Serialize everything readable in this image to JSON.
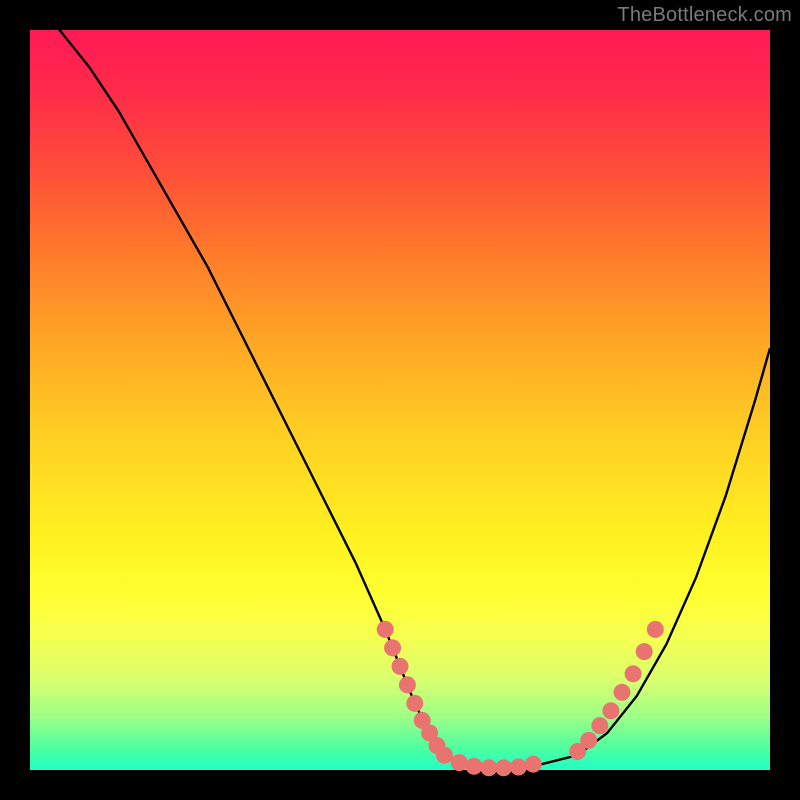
{
  "watermark": "TheBottleneck.com",
  "colors": {
    "background": "#000000",
    "curve": "#000000",
    "dot": "#e9736f"
  },
  "chart_data": {
    "type": "line",
    "title": "",
    "xlabel": "",
    "ylabel": "",
    "xlim": [
      0,
      100
    ],
    "ylim": [
      0,
      100
    ],
    "grid": false,
    "legend": false,
    "series": [
      {
        "name": "bottleneck-curve",
        "x": [
          0,
          4,
          8,
          12,
          16,
          20,
          24,
          28,
          32,
          36,
          40,
          44,
          48,
          50,
          52,
          54,
          56,
          58,
          60,
          62,
          64,
          66,
          70,
          74,
          78,
          82,
          86,
          90,
          94,
          98,
          100
        ],
        "y": [
          104,
          100,
          95,
          89,
          82,
          75,
          68,
          60,
          52,
          44,
          36,
          28,
          19,
          14,
          9,
          5,
          2,
          1,
          0,
          0,
          0,
          0,
          1,
          2,
          5,
          10,
          17,
          26,
          37,
          50,
          57
        ]
      }
    ],
    "highlight_points": {
      "left_slope": [
        {
          "x": 48,
          "y": 19
        },
        {
          "x": 49,
          "y": 16.5
        },
        {
          "x": 50,
          "y": 14
        },
        {
          "x": 51,
          "y": 11.5
        },
        {
          "x": 52,
          "y": 9
        },
        {
          "x": 53,
          "y": 6.7
        },
        {
          "x": 54,
          "y": 5
        },
        {
          "x": 55,
          "y": 3.3
        },
        {
          "x": 56,
          "y": 2
        }
      ],
      "valley": [
        {
          "x": 58,
          "y": 1
        },
        {
          "x": 60,
          "y": 0.5
        },
        {
          "x": 62,
          "y": 0.3
        },
        {
          "x": 64,
          "y": 0.3
        },
        {
          "x": 66,
          "y": 0.4
        },
        {
          "x": 68,
          "y": 0.8
        }
      ],
      "right_slope": [
        {
          "x": 74,
          "y": 2.5
        },
        {
          "x": 75.5,
          "y": 4
        },
        {
          "x": 77,
          "y": 6
        },
        {
          "x": 78.5,
          "y": 8
        },
        {
          "x": 80,
          "y": 10.5
        },
        {
          "x": 81.5,
          "y": 13
        },
        {
          "x": 83,
          "y": 16
        },
        {
          "x": 84.5,
          "y": 19
        }
      ]
    }
  }
}
